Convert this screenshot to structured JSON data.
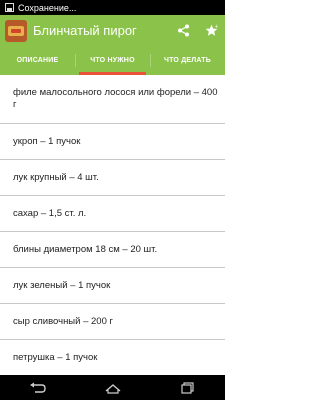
{
  "status_bar": {
    "text": "Сохранение...",
    "icon": "image-icon"
  },
  "action_bar": {
    "title": "Блинчатый пирог",
    "app_icon": "recipe-thumbnail",
    "actions": [
      "share-icon",
      "favorite-star-icon"
    ],
    "background": "#8bc34a"
  },
  "tabs": [
    {
      "label": "ОПИСАНИЕ",
      "active": false
    },
    {
      "label": "ЧТО НУЖНО",
      "active": true
    },
    {
      "label": "ЧТО ДЕЛАТЬ",
      "active": false
    }
  ],
  "tab_indicator_color": "#e8533a",
  "ingredients": [
    "филе малосольного лосося или форели – 400 г",
    "укроп – 1 пучок",
    "лук крупный – 4  шт.",
    "сахар – 1,5 ст. л.",
    "блины диаметром 18 см – 20 шт.",
    "лук зеленый – 1 пучок",
    "сыр сливочный – 200 г",
    "петрушка – 1 пучок"
  ],
  "nav_bar": {
    "buttons": [
      "back-icon",
      "home-icon",
      "recent-apps-icon"
    ]
  }
}
